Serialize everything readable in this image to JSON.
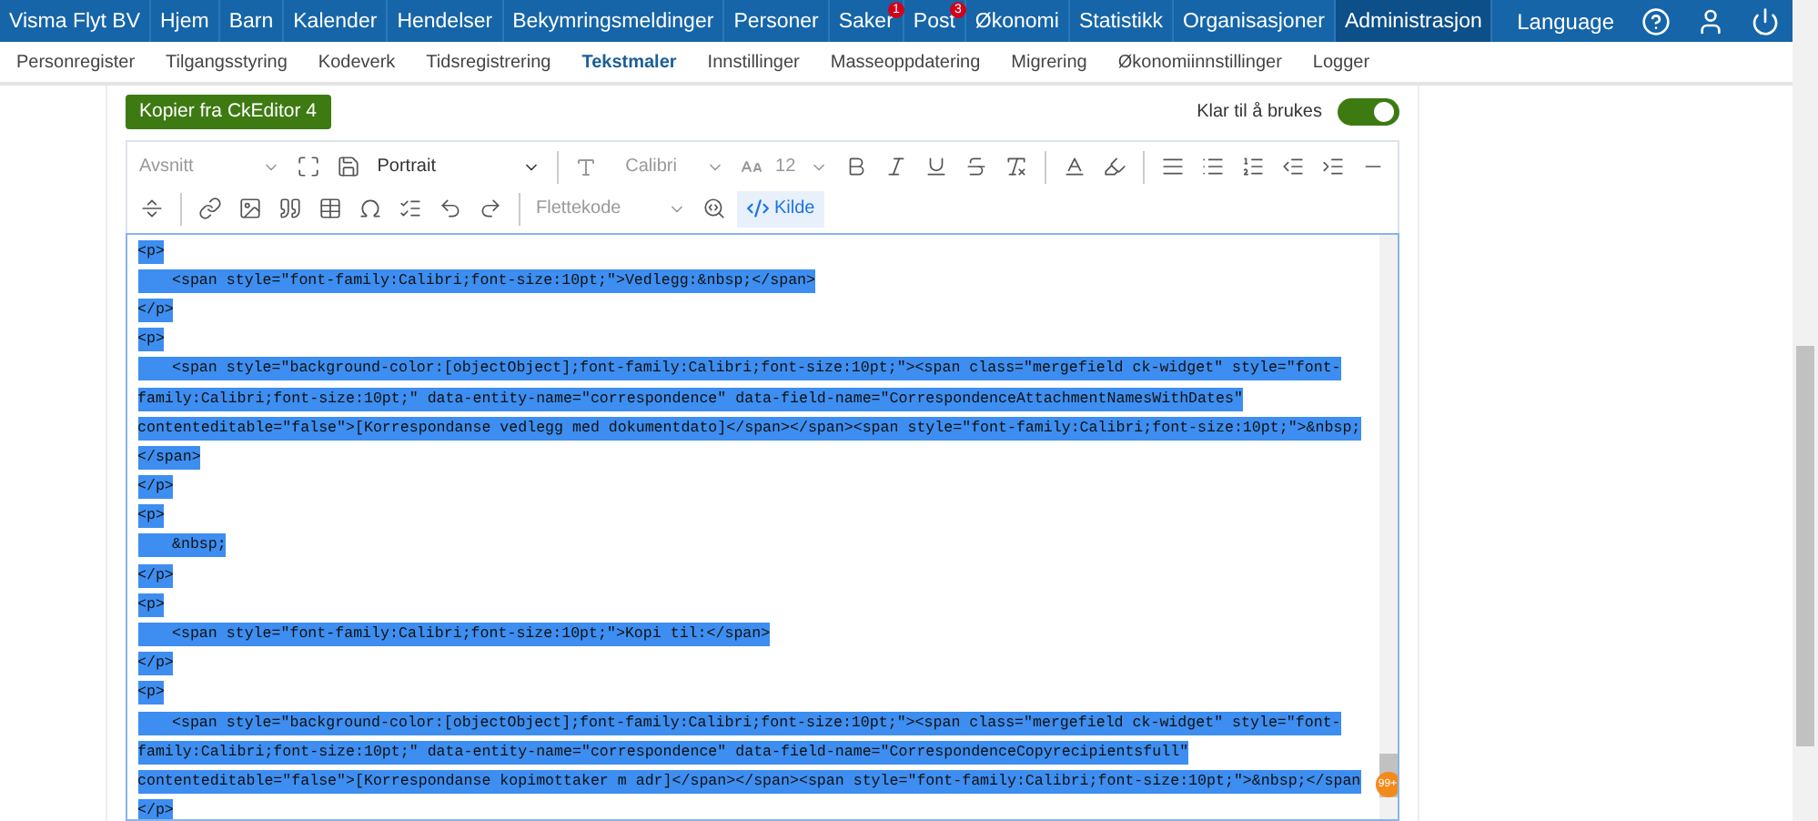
{
  "top_nav": {
    "items": [
      {
        "label": "Visma Flyt BV",
        "selected": false
      },
      {
        "label": "Hjem",
        "selected": false
      },
      {
        "label": "Barn",
        "selected": false
      },
      {
        "label": "Kalender",
        "selected": false
      },
      {
        "label": "Hendelser",
        "selected": false
      },
      {
        "label": "Bekymringsmeldinger",
        "selected": false
      },
      {
        "label": "Personer",
        "selected": false
      },
      {
        "label": "Saker",
        "selected": false,
        "badge": "1"
      },
      {
        "label": "Post",
        "selected": false,
        "badge": "3"
      },
      {
        "label": "Økonomi",
        "selected": false
      },
      {
        "label": "Statistikk",
        "selected": false
      },
      {
        "label": "Organisasjoner",
        "selected": false
      },
      {
        "label": "Administrasjon",
        "selected": true
      }
    ],
    "language": "Language"
  },
  "sub_nav": [
    {
      "label": "Personregister",
      "selected": false
    },
    {
      "label": "Tilgangsstyring",
      "selected": false
    },
    {
      "label": "Kodeverk",
      "selected": false
    },
    {
      "label": "Tidsregistrering",
      "selected": false
    },
    {
      "label": "Tekstmaler",
      "selected": true
    },
    {
      "label": "Innstillinger",
      "selected": false
    },
    {
      "label": "Masseoppdatering",
      "selected": false
    },
    {
      "label": "Migrering",
      "selected": false
    },
    {
      "label": "Økonomiinnstillinger",
      "selected": false
    },
    {
      "label": "Logger",
      "selected": false
    }
  ],
  "copy_button": "Kopier fra CkEditor 4",
  "ready_toggle": {
    "label": "Klar til å brukes",
    "on": true
  },
  "toolbar": {
    "paragraph_style": "Avsnitt",
    "orientation": "Portrait",
    "font": "Calibri",
    "font_size": "12",
    "merge_code": "Flettekode",
    "source_button": {
      "label": "Kilde",
      "selected": true
    }
  },
  "source": {
    "badge": "99+",
    "blocks": [
      {
        "open": "<p>",
        "children": [
          {
            "lines": [
              "<span style=\"font-family:Calibri;font-size:10pt;\">Vedlegg:&nbsp;</span>"
            ]
          }
        ],
        "close": "</p>"
      },
      {
        "open": "<p>",
        "children": [
          {
            "lines": [
              "<span style=\"background-color:[objectObject];font-family:Calibri;font-size:10pt;\"><span class=\"mergefield ck-widget\" style=\"font-",
              "family:Calibri;font-size:10pt;\" data-entity-name=\"correspondence\" data-field-name=\"CorrespondenceAttachmentNamesWithDates\"",
              "contenteditable=\"false\">[Korrespondanse vedlegg med dokumentdato]</span></span><span style=\"font-family:Calibri;font-size:10pt;\">&nbsp;",
              "</span>"
            ]
          }
        ],
        "close": "</p>"
      },
      {
        "open": "<p>",
        "children": [
          {
            "lines": [
              "&nbsp;"
            ]
          }
        ],
        "close": "</p>"
      },
      {
        "open": "<p>",
        "children": [
          {
            "lines": [
              "<span style=\"font-family:Calibri;font-size:10pt;\">Kopi til:</span>"
            ]
          }
        ],
        "close": "</p>"
      },
      {
        "open": "<p>",
        "children": [
          {
            "lines": [
              "<span style=\"background-color:[objectObject];font-family:Calibri;font-size:10pt;\"><span class=\"mergefield ck-widget\" style=\"font-",
              "family:Calibri;font-size:10pt;\" data-entity-name=\"correspondence\" data-field-name=\"CorrespondenceCopyrecipientsfull\"",
              "contenteditable=\"false\">[Korrespondanse kopimottaker m adr]</span></span><span style=\"font-family:Calibri;font-size:10pt;\">&nbsp;</span"
            ]
          }
        ],
        "close": "</p>"
      }
    ]
  }
}
